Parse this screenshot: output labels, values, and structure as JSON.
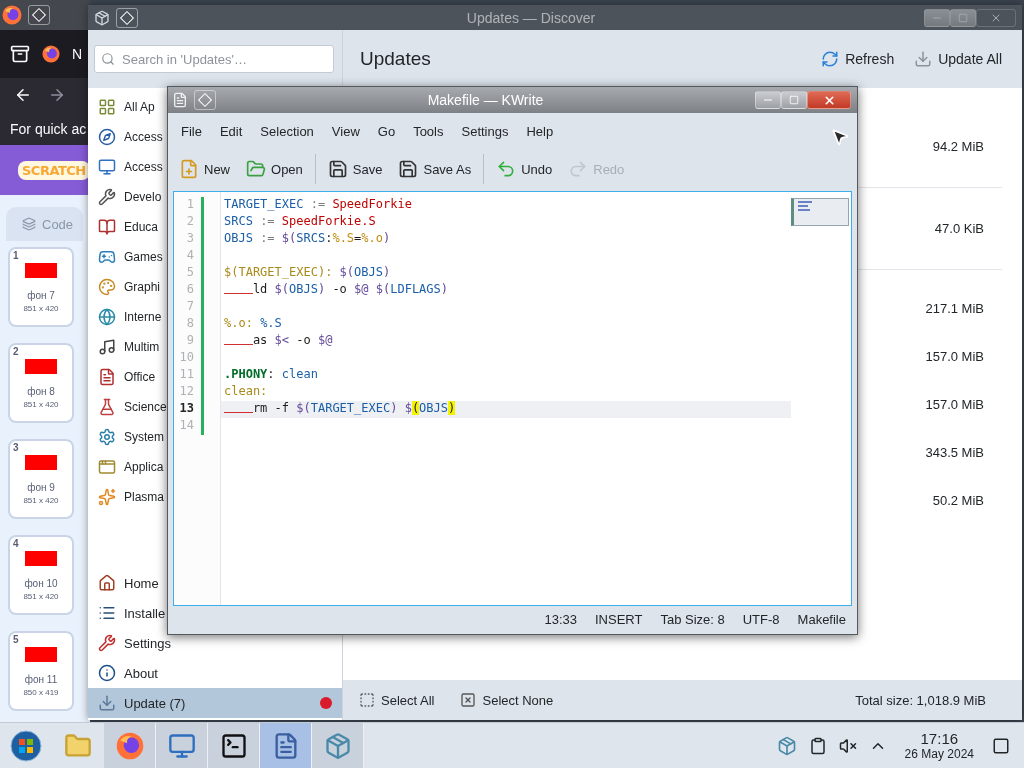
{
  "firefox": {
    "tab_label": "N",
    "hint": "For quick ac",
    "logo": "SCRATCH",
    "code_tab": "Code",
    "costumes": [
      {
        "number": "1",
        "name": "фон 7",
        "size": "851 x 420"
      },
      {
        "number": "2",
        "name": "фон 8",
        "size": "851 x 420"
      },
      {
        "number": "3",
        "name": "фон 9",
        "size": "851 x 420"
      },
      {
        "number": "4",
        "name": "фон 10",
        "size": "851 x 420"
      },
      {
        "number": "5",
        "name": "фон 11",
        "size": "850 x 419"
      }
    ]
  },
  "discover": {
    "title": "Updates — Discover",
    "search": {
      "placeholder": "Search in 'Updates'…"
    },
    "categories": [
      {
        "label": "All Ap"
      },
      {
        "label": "Access"
      },
      {
        "label": "Access"
      },
      {
        "label": "Develo"
      },
      {
        "label": "Educa"
      },
      {
        "label": "Games"
      },
      {
        "label": "Graphi"
      },
      {
        "label": "Interne"
      },
      {
        "label": "Multim"
      },
      {
        "label": "Office"
      },
      {
        "label": "Science"
      },
      {
        "label": "System"
      },
      {
        "label": "Applica"
      },
      {
        "label": "Plasma"
      }
    ],
    "bottom_items": [
      {
        "label": "Home",
        "selected": false,
        "alert": false
      },
      {
        "label": "Installe",
        "selected": false,
        "alert": false
      },
      {
        "label": "Settings",
        "selected": false,
        "alert": false
      },
      {
        "label": "About",
        "selected": false,
        "alert": false
      },
      {
        "label": "Update (7)",
        "selected": true,
        "alert": true
      }
    ],
    "heading": "Updates",
    "actions": [
      "Refresh",
      "Update All"
    ],
    "groups": [
      {
        "kind": "application",
        "rows": [
          {
            "size": "94.2 MiB"
          },
          {
            "size": "47.0 KiB"
          }
        ]
      },
      {
        "kind": "system",
        "rows": [
          {
            "size": "217.1 MiB"
          },
          {
            "size": "157.0 MiB"
          },
          {
            "size": "157.0 MiB"
          },
          {
            "size": "343.5 MiB"
          },
          {
            "size": "50.2 MiB"
          }
        ]
      }
    ],
    "footer": {
      "select_all": "Select All",
      "select_none": "Select None",
      "total": "Total size: 1,018.9 MiB"
    }
  },
  "kwrite": {
    "title": "Makefile — KWrite",
    "menu": [
      "File",
      "Edit",
      "Selection",
      "View",
      "Go",
      "Tools",
      "Settings",
      "Help"
    ],
    "toolbar": [
      {
        "label": "New",
        "disabled": false
      },
      {
        "label": "Open",
        "disabled": false
      },
      {
        "label": "Save",
        "disabled": false
      },
      {
        "label": "Save As",
        "disabled": false
      },
      {
        "label": "Undo",
        "disabled": false
      },
      {
        "label": "Redo",
        "disabled": true
      }
    ],
    "lines": [
      {
        "number": "1",
        "current": false,
        "tokens": [
          {
            "kind": "var",
            "text": "TARGET_EXEC"
          },
          {
            "kind": "op",
            "text": " := "
          },
          {
            "kind": "str",
            "text": "SpeedForkie"
          }
        ]
      },
      {
        "number": "2",
        "current": false,
        "tokens": [
          {
            "kind": "var",
            "text": "SRCS"
          },
          {
            "kind": "op",
            "text": " := "
          },
          {
            "kind": "str",
            "text": "SpeedForkie.S"
          }
        ]
      },
      {
        "number": "3",
        "current": false,
        "tokens": [
          {
            "kind": "var",
            "text": "OBJS"
          },
          {
            "kind": "op",
            "text": " := "
          },
          {
            "kind": "sub",
            "text": "$("
          },
          {
            "kind": "var",
            "text": "SRCS"
          },
          {
            "kind": "plain",
            "text": ":"
          },
          {
            "kind": "pat",
            "text": "%.S"
          },
          {
            "kind": "plain",
            "text": "="
          },
          {
            "kind": "pat",
            "text": "%.o"
          },
          {
            "kind": "sub",
            "text": ")"
          }
        ]
      },
      {
        "number": "4",
        "current": false
      },
      {
        "number": "5",
        "current": false,
        "tokens": [
          {
            "kind": "target",
            "text": "$(TARGET_EXEC): "
          },
          {
            "kind": "sub",
            "text": "$("
          },
          {
            "kind": "var",
            "text": "OBJS"
          },
          {
            "kind": "sub",
            "text": ")"
          }
        ]
      },
      {
        "number": "6",
        "current": false,
        "tokens": [
          {
            "kind": "tab"
          },
          {
            "kind": "plain",
            "text": "ld "
          },
          {
            "kind": "sub",
            "text": "$("
          },
          {
            "kind": "var",
            "text": "OBJS"
          },
          {
            "kind": "sub",
            "text": ")"
          },
          {
            "kind": "plain",
            "text": " -o "
          },
          {
            "kind": "sub",
            "text": "$@"
          },
          {
            "kind": "sub",
            "text": " $("
          },
          {
            "kind": "var",
            "text": "LDFLAGS"
          },
          {
            "kind": "sub",
            "text": ")"
          }
        ]
      },
      {
        "number": "7",
        "current": false
      },
      {
        "number": "8",
        "current": false,
        "tokens": [
          {
            "kind": "target",
            "text": "%.o: "
          },
          {
            "kind": "var",
            "text": "%.S"
          }
        ]
      },
      {
        "number": "9",
        "current": false,
        "tokens": [
          {
            "kind": "tab"
          },
          {
            "kind": "plain",
            "text": "as "
          },
          {
            "kind": "sub",
            "text": "$<"
          },
          {
            "kind": "plain",
            "text": " -o "
          },
          {
            "kind": "sub",
            "text": "$@"
          }
        ]
      },
      {
        "number": "10",
        "current": false
      },
      {
        "number": "11",
        "current": false,
        "tokens": [
          {
            "kind": "kw",
            "text": ".PHONY"
          },
          {
            "kind": "plain",
            "text": ": "
          },
          {
            "kind": "var",
            "text": "clean"
          }
        ]
      },
      {
        "number": "12",
        "current": false,
        "tokens": [
          {
            "kind": "target",
            "text": "clean:"
          }
        ]
      },
      {
        "number": "13",
        "current": true,
        "tokens": [
          {
            "kind": "tab"
          },
          {
            "kind": "plain",
            "text": "rm -f "
          },
          {
            "kind": "sub",
            "text": "$("
          },
          {
            "kind": "var",
            "text": "TARGET_EXEC"
          },
          {
            "kind": "sub",
            "text": ") $"
          },
          {
            "kind": "bracket",
            "text": "("
          },
          {
            "kind": "var",
            "text": "OBJS"
          },
          {
            "kind": "bracket",
            "text": ")"
          }
        ]
      },
      {
        "number": "14",
        "current": false
      }
    ],
    "status": [
      "13:33",
      "INSERT",
      "Tab Size: 8",
      "UTF-8",
      "Makefile"
    ]
  },
  "taskbar": {
    "apps": [
      {
        "open": false,
        "selected": false
      },
      {
        "open": false,
        "selected": false
      },
      {
        "open": true,
        "selected": false
      },
      {
        "open": true,
        "selected": false
      },
      {
        "open": true,
        "selected": false
      },
      {
        "open": true,
        "selected": true
      },
      {
        "open": true,
        "selected": false
      }
    ],
    "clock": {
      "time": "17:16",
      "date": "26 May 2024"
    }
  }
}
